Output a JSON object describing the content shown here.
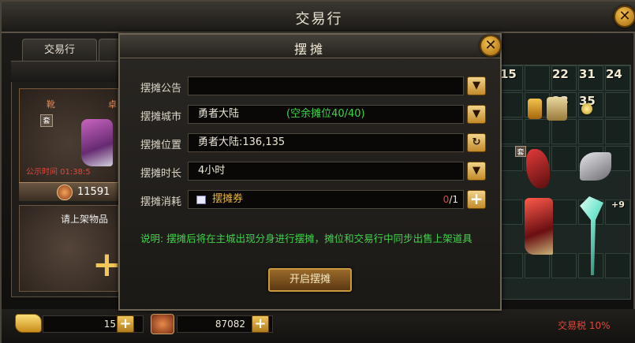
{
  "window": {
    "title": "交易行"
  },
  "tabs": [
    {
      "label": "交易行"
    }
  ],
  "left": {
    "item_name_left": "靴",
    "item_name_right": "卓",
    "item_badge": "套",
    "publish_time": "公示时间 01:38:5",
    "item_price": "11591",
    "empty_slot_label": "请上架物品"
  },
  "grid": {
    "counts": [
      "15",
      "22",
      "31",
      "24",
      "23",
      "35"
    ],
    "badge": "套",
    "plus_level": "+9"
  },
  "bottom": {
    "gold_amount": "15",
    "gem_amount": "87082",
    "tax_label": "交易税 10%"
  },
  "modal": {
    "title": "摆摊",
    "rows": [
      {
        "label": "摆摊公告",
        "value": ""
      },
      {
        "label": "摆摊城市",
        "value": "勇者大陆",
        "extra": "(空余摊位40/40)"
      },
      {
        "label": "摆摊位置",
        "value": "勇者大陆:136,135"
      },
      {
        "label": "摆摊时长",
        "value": "4小时"
      },
      {
        "label": "摆摊消耗",
        "value": "摆摊券"
      }
    ],
    "cost_have": "0",
    "cost_need": "/1",
    "description": "说明:  摆摊后将在主城出现分身进行摆摊，摊位和交易行中同步出售上架道具",
    "open_button": "开启摆摊"
  },
  "colors": {
    "accent": "#f2c75a",
    "green_text": "#3fd44a",
    "red_text": "#e0473c"
  }
}
